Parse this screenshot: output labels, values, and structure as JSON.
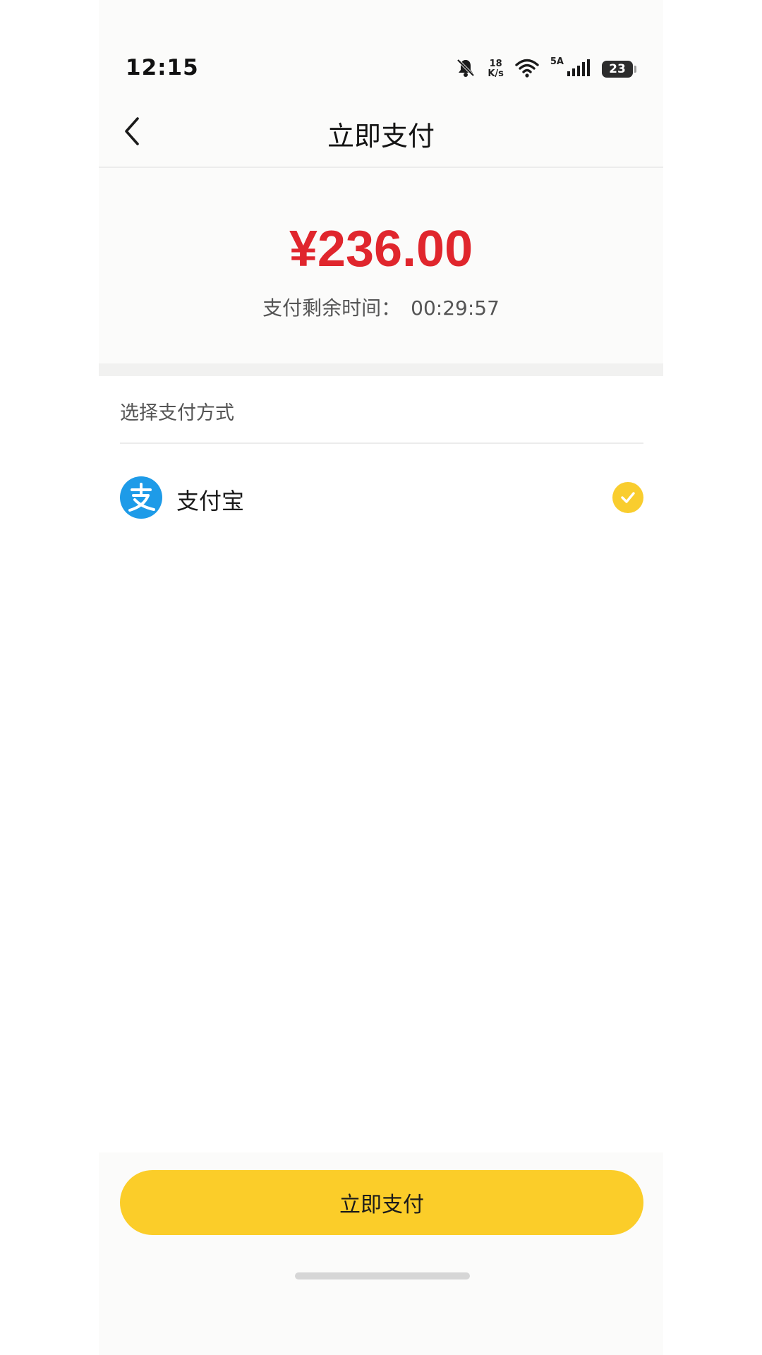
{
  "status_bar": {
    "time": "12:15",
    "net_speed_value": "18",
    "net_speed_unit": "K/s",
    "signal_label": "5A",
    "battery": "23"
  },
  "header": {
    "title": "立即支付",
    "back_icon": "chevron-left-icon"
  },
  "payment": {
    "amount": "¥236.00",
    "countdown_label": "支付剩余时间：",
    "countdown_value": "00:29:57"
  },
  "methods": {
    "section_label": "选择支付方式",
    "options": [
      {
        "label": "支付宝",
        "icon": "alipay-icon",
        "selected": true
      }
    ]
  },
  "actions": {
    "pay_label": "立即支付"
  },
  "colors": {
    "amount": "#e0262d",
    "accent": "#fbcd29",
    "alipay_blue": "#1e9be8"
  }
}
